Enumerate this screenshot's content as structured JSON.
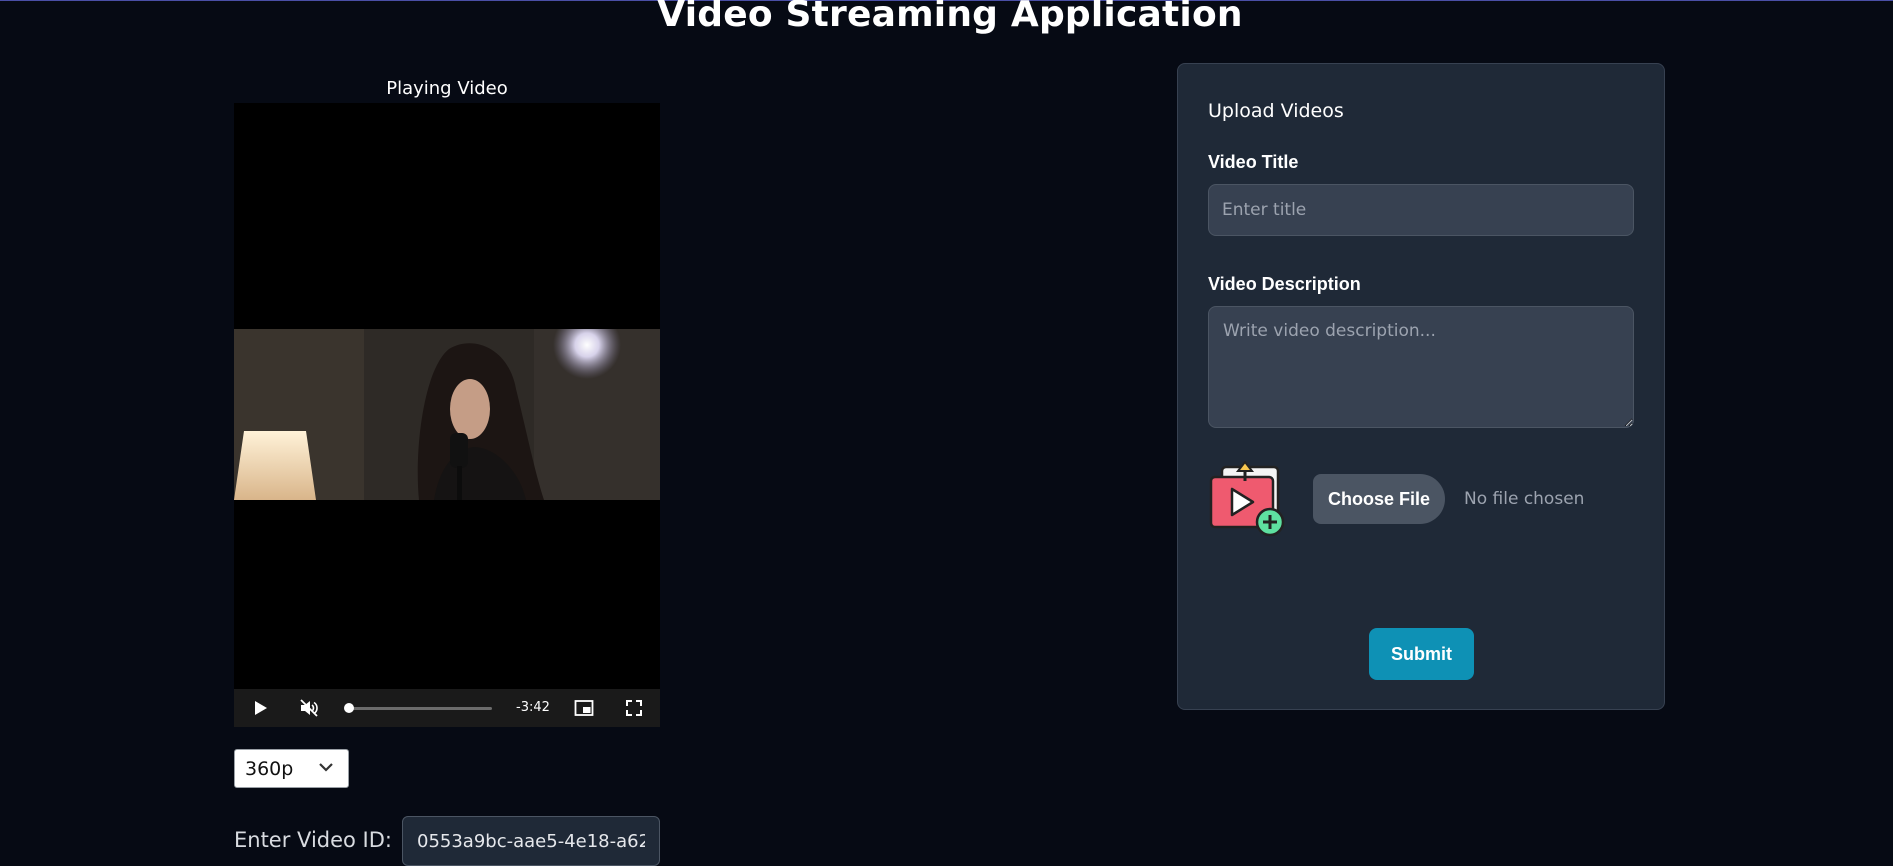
{
  "app": {
    "title": "Video Streaming Application"
  },
  "player": {
    "heading": "Playing Video",
    "time_remaining": "-3:42",
    "progress": 0.02,
    "muted": true,
    "icons": [
      "play-icon",
      "mute-icon",
      "picture-in-picture-icon",
      "fullscreen-icon"
    ]
  },
  "quality_select": {
    "selected": "360p"
  },
  "video_id": {
    "label": "Enter Video ID:",
    "value": "0553a9bc-aae5-4e18-a62"
  },
  "upload": {
    "title": "Upload Videos",
    "title_label": "Video Title",
    "title_placeholder": "Enter title",
    "description_label": "Video Description",
    "description_placeholder": "Write video description...",
    "choose_file_label": "Choose File",
    "no_file_text": "No file chosen",
    "submit_label": "Submit"
  },
  "colors": {
    "background": "#060a14",
    "card": "#1f2937",
    "input": "#374151",
    "submit": "#0e91b5"
  }
}
